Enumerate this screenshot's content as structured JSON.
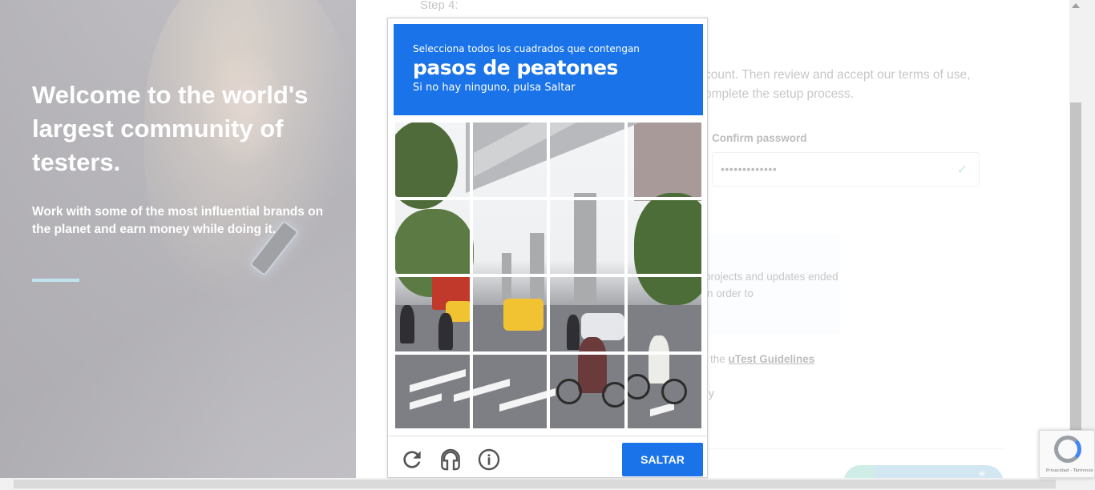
{
  "hero": {
    "headline": "Welcome to the world's largest community of testers.",
    "subtext": "Work with some of the most influential brands on the planet and earn money while doing it.",
    "accent_color": "#7ec9dc"
  },
  "form": {
    "step_label": "Step 4:",
    "intro_text": "count. Then review and accept our terms of use, omplete the setup process.",
    "confirm_password_label": "Confirm password",
    "confirm_password_value": "•••••••••••••",
    "valid_icon": "check-icon",
    "info_text": "projects and updates ended in order to",
    "guidelines_prefix": "the",
    "guidelines_link": "uTest Guidelines",
    "fragment_y": "y"
  },
  "captcha": {
    "instruction_small": "Selecciona todos los cuadrados que contengan",
    "target": "pasos de peatones",
    "hint": "Si no hay ninguno, pulsa Saltar",
    "skip_label": "SALTAR",
    "reload_icon": "reload-icon",
    "audio_icon": "headphones-icon",
    "info_icon": "info-icon",
    "accent_color": "#1a73e8",
    "grid_size": 4
  },
  "badge": {
    "links": "Privacidad - Términos"
  }
}
